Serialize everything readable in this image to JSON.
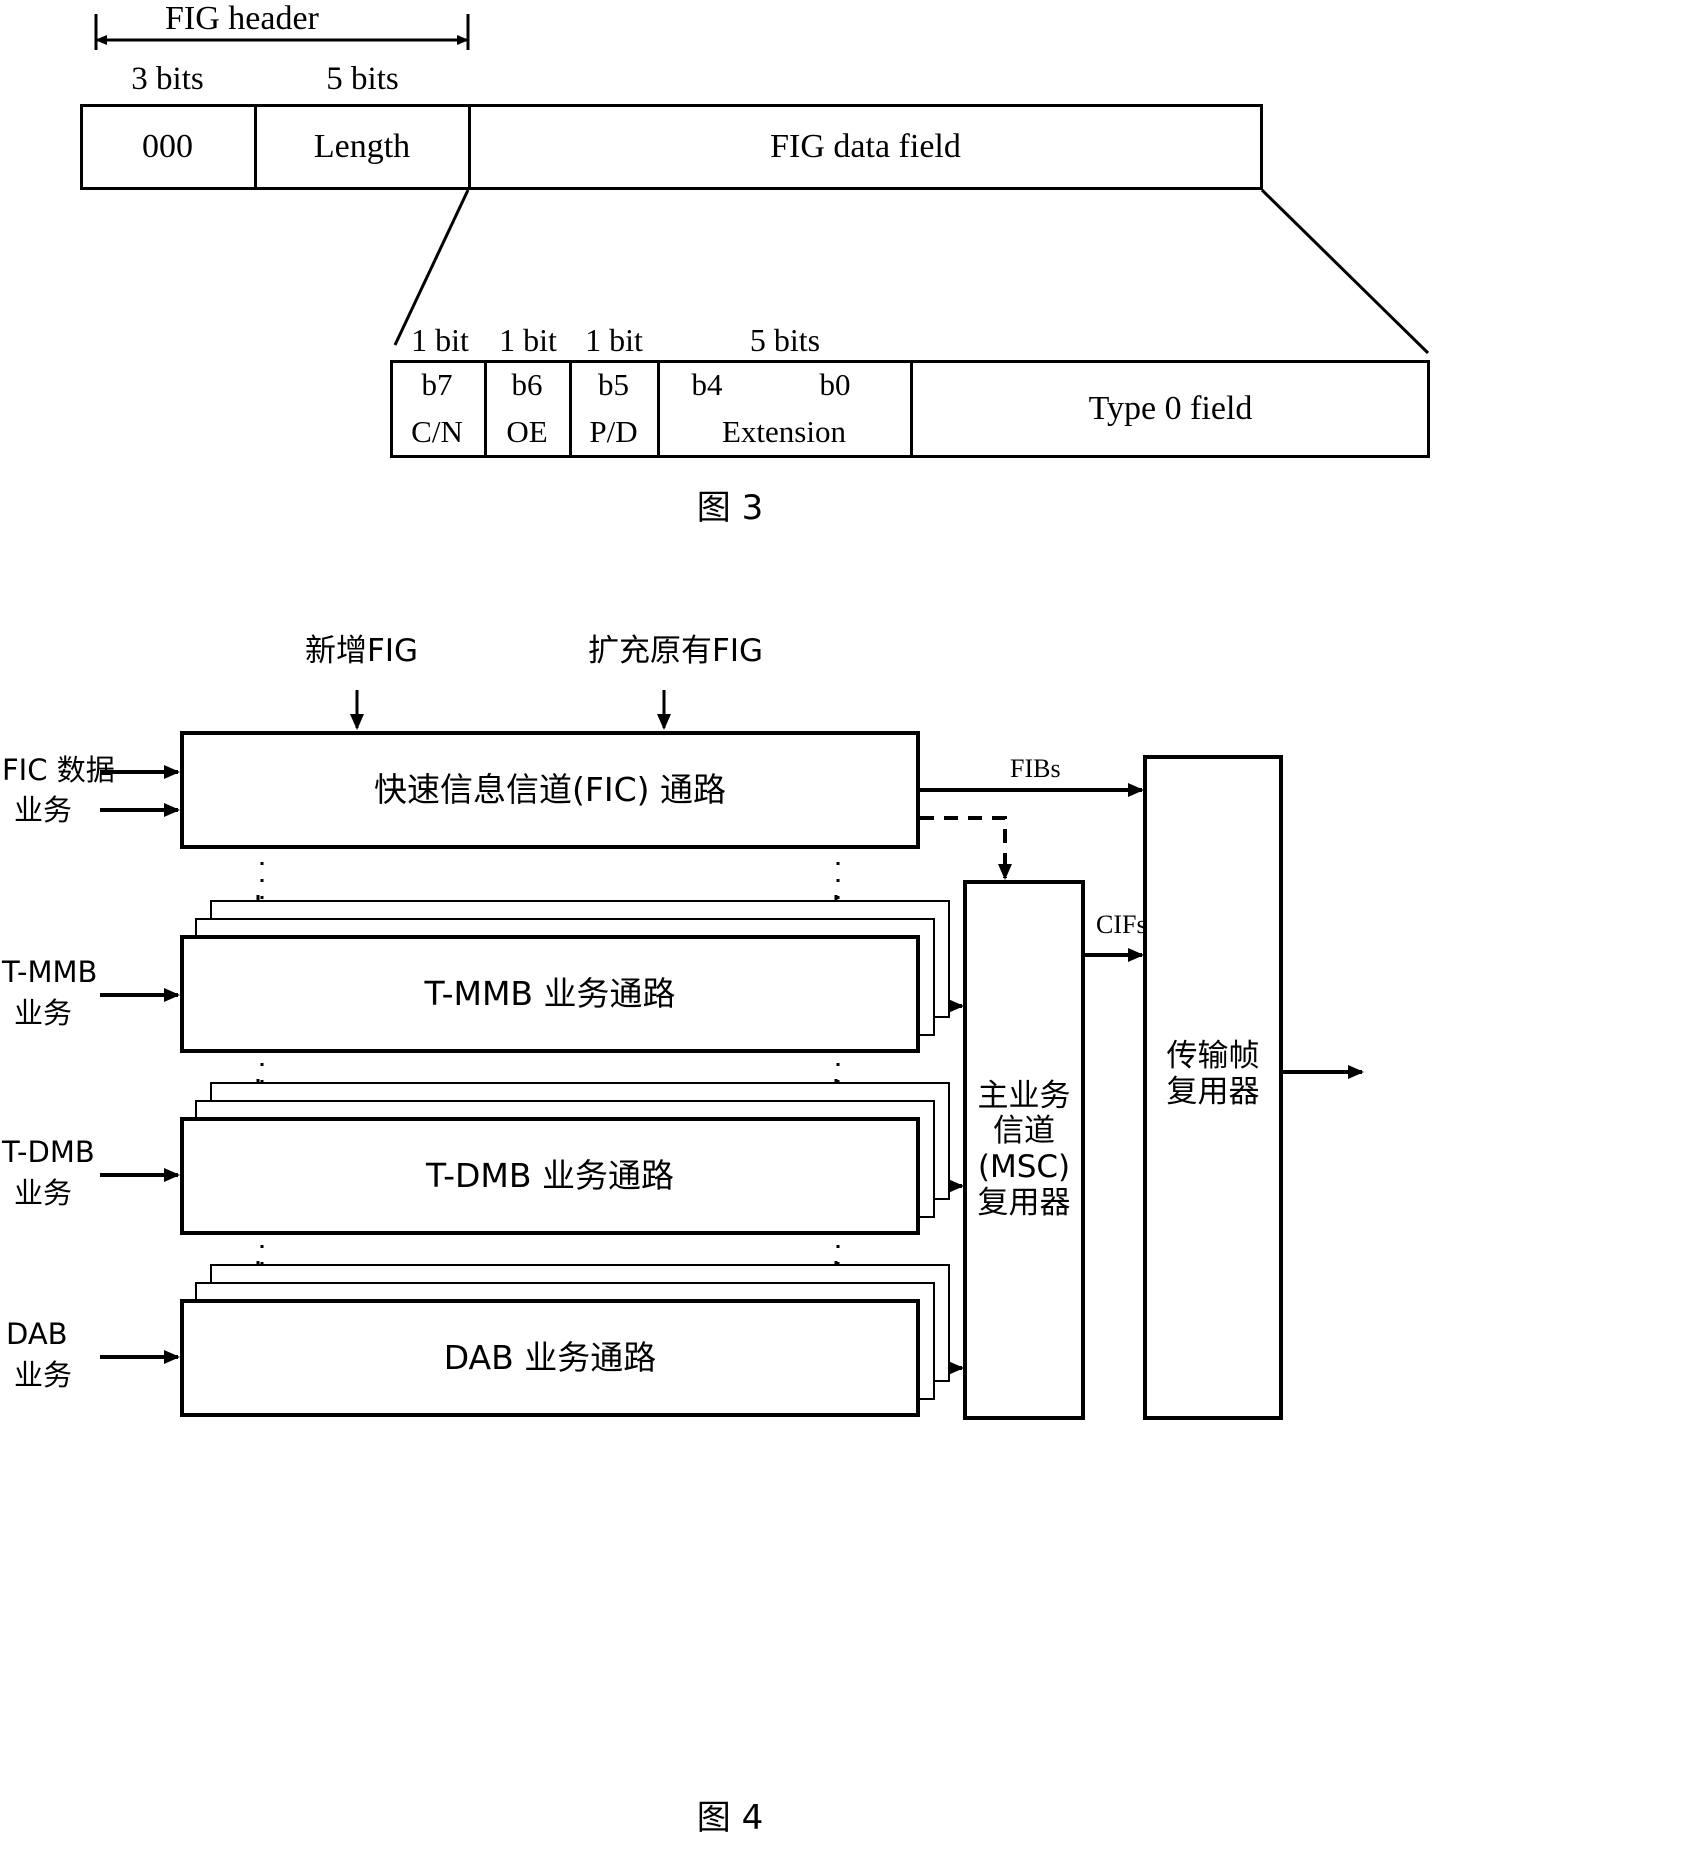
{
  "document": {
    "type": "patent-figure-sheet",
    "figures": [
      {
        "id": "fig3",
        "caption": "图 3",
        "title_label": "FIG header",
        "header_bits": [
          {
            "label": "3 bits",
            "value": "000"
          },
          {
            "label": "5 bits",
            "value": "Length"
          }
        ],
        "data_field_label": "FIG data field",
        "expansion": {
          "bit_labels": [
            "1 bit",
            "1 bit",
            "1 bit",
            "5 bits"
          ],
          "cells": [
            {
              "bit": "b7",
              "name": "C/N"
            },
            {
              "bit": "b6",
              "name": "OE"
            },
            {
              "bit": "b5",
              "name": "P/D"
            },
            {
              "bit": "b4",
              "bit_end": "b0",
              "name": "Extension"
            }
          ],
          "tail_label": "Type 0 field"
        }
      },
      {
        "id": "fig4",
        "caption": "图 4",
        "top_annotations": [
          {
            "label": "新增FIG"
          },
          {
            "label": "扩充原有FIG"
          }
        ],
        "inputs": [
          {
            "line1": "FIC 数据",
            "line2": "业务"
          },
          {
            "line1": "T-MMB",
            "line2": "业务"
          },
          {
            "line1": "T-DMB",
            "line2": "业务"
          },
          {
            "line1": "DAB",
            "line2": "业务"
          }
        ],
        "paths": [
          {
            "label": "快速信息信道(FIC) 通路",
            "stacked": false
          },
          {
            "label": "T-MMB 业务通路",
            "stacked": true
          },
          {
            "label": "T-DMB 业务通路",
            "stacked": true
          },
          {
            "label": "DAB 业务通路",
            "stacked": true
          }
        ],
        "signal_labels": [
          {
            "name": "fibs",
            "text": "FIBs"
          },
          {
            "name": "cifs",
            "text": "CIFs"
          }
        ],
        "msc_multiplexer": {
          "lines": [
            "主业务",
            "信道",
            "(MSC)",
            "复用器"
          ]
        },
        "frame_multiplexer": {
          "lines": [
            "传输帧",
            "复用器"
          ]
        }
      }
    ]
  }
}
